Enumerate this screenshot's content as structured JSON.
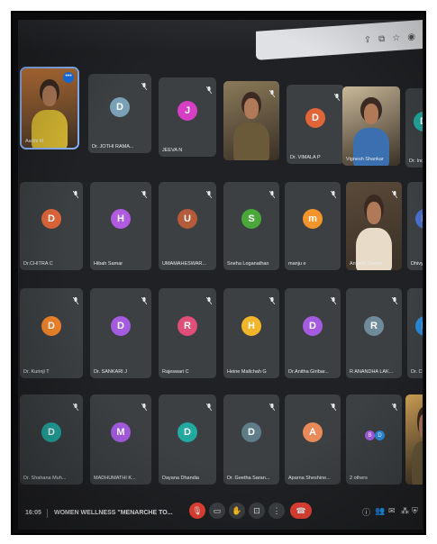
{
  "browser": {
    "icons": [
      "share-icon",
      "extension-icon",
      "star-icon",
      "profile-icon"
    ]
  },
  "tiles": [
    {
      "id": "t1",
      "name": "Aarthi M",
      "type": "video",
      "self": true,
      "more": "•••"
    },
    {
      "id": "t2",
      "name": "Dr. JOTHI RAMA...",
      "initial": "D",
      "color": "#7aa0b5"
    },
    {
      "id": "t3",
      "name": "JEEVA N",
      "initial": "J",
      "color": "#d63fc4"
    },
    {
      "id": "t4",
      "name": "",
      "type": "video"
    },
    {
      "id": "t5",
      "name": "Dr. VIMALA P",
      "initial": "D",
      "color": "#e0663a"
    },
    {
      "id": "t6",
      "name": "Vignesh Shankar",
      "type": "video"
    },
    {
      "id": "t7",
      "name": "Dr. Indumathi",
      "initial": "D",
      "color": "#22a9a0"
    },
    {
      "id": "t8",
      "name": "Dr.CHITRA C",
      "initial": "D",
      "color": "#e0663a"
    },
    {
      "id": "t9",
      "name": "Hibah Samar",
      "initial": "H",
      "color": "#b15be0"
    },
    {
      "id": "t10",
      "name": "UMAMAHESWAR...",
      "initial": "U",
      "color": "#b55a3a"
    },
    {
      "id": "t11",
      "name": "Sneha Loganathan",
      "initial": "S",
      "color": "#4aa83a"
    },
    {
      "id": "t12",
      "name": "manju e",
      "initial": "m",
      "color": "#f2952a"
    },
    {
      "id": "t13",
      "name": "Angelin Deepa",
      "type": "photo"
    },
    {
      "id": "t14",
      "name": "Dhivya R.K.S",
      "initial": "D",
      "color": "#4a6fc9"
    },
    {
      "id": "t15",
      "name": "Dr. Kurinji T",
      "initial": "D",
      "color": "#f2852a"
    },
    {
      "id": "t16",
      "name": "Dr. SANKARI J",
      "initial": "D",
      "color": "#a45be0"
    },
    {
      "id": "t17",
      "name": "Rajeswari C",
      "initial": "R",
      "color": "#e04e7a"
    },
    {
      "id": "t18",
      "name": "Heine Mallchah G",
      "initial": "H",
      "color": "#f2b52a"
    },
    {
      "id": "t19",
      "name": "Dr.Anitha Giribar...",
      "initial": "D",
      "color": "#a45be0"
    },
    {
      "id": "t20",
      "name": "R ANANDHA LAK...",
      "initial": "R",
      "color": "#6f8b9a"
    },
    {
      "id": "t21",
      "name": "Dr. CHITHRA M",
      "initial": "D",
      "color": "#2a8ad6"
    },
    {
      "id": "t22",
      "name": "Dr. Shahana Muh...",
      "initial": "D",
      "color": "#22a9a0"
    },
    {
      "id": "t23",
      "name": "MADHUMATHI K...",
      "initial": "M",
      "color": "#a45be0"
    },
    {
      "id": "t24",
      "name": "Dayana Dhandia",
      "initial": "D",
      "color": "#22a9a0"
    },
    {
      "id": "t25",
      "name": "Dr. Geetha Saran...",
      "initial": "D",
      "color": "#5f7d88"
    },
    {
      "id": "t26",
      "name": "Aparna Sheshine...",
      "initial": "A",
      "color": "#e88a5a"
    },
    {
      "id": "t27",
      "name": "2 others",
      "type": "others",
      "a": "B",
      "a_color": "#a45be0",
      "b": "D",
      "b_color": "#2a8ad6"
    },
    {
      "id": "t28",
      "name": "",
      "type": "video"
    }
  ],
  "bottom": {
    "time": "16:05",
    "title": "WOMEN WELLNESS \"MENARCHE TO...",
    "controls": [
      "mic-off-icon",
      "camera-icon",
      "raise-hand-icon",
      "present-icon",
      "more-options-icon",
      "end-call-icon"
    ],
    "right_controls": [
      "info-icon",
      "people-icon",
      "chat-icon",
      "activities-icon",
      "host-controls-icon"
    ],
    "colors": {
      "end_call": "#ea4335",
      "accent": "#8ab4f8"
    }
  }
}
